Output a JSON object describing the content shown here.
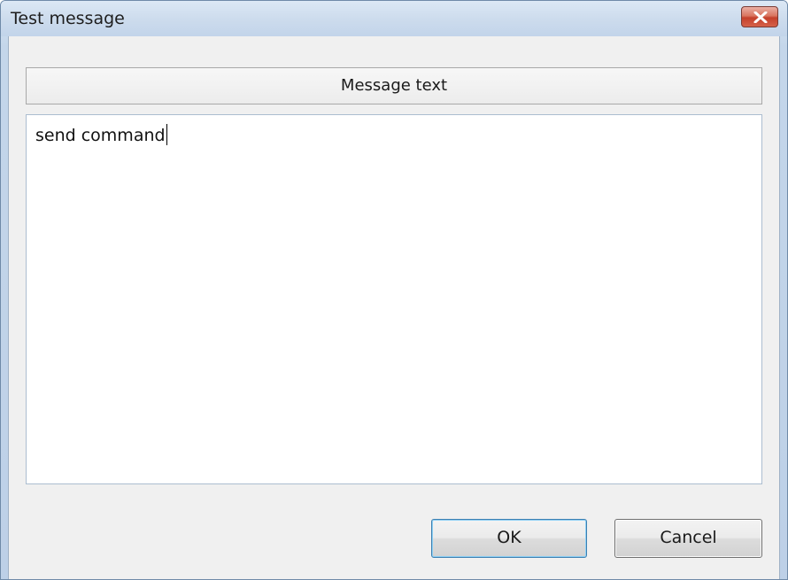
{
  "window": {
    "title": "Test message"
  },
  "icons": {
    "close": "close-icon"
  },
  "header": {
    "label": "Message text"
  },
  "message": {
    "value": "send command"
  },
  "buttons": {
    "ok_label": "OK",
    "cancel_label": "Cancel"
  },
  "colors": {
    "close_button": "#c4402b",
    "default_button_border": "#3c7fb1"
  }
}
